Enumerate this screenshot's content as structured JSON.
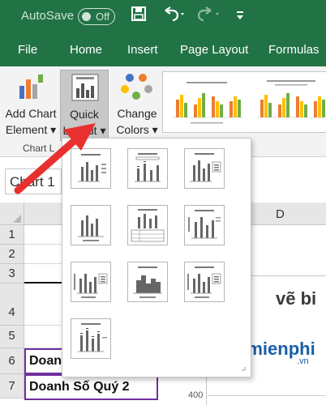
{
  "titlebar": {
    "autosave": "AutoSave",
    "toggle_state": "Off"
  },
  "tabs": [
    "File",
    "Home",
    "Insert",
    "Page Layout",
    "Formulas"
  ],
  "ribbon": {
    "add_chart": [
      "Add Chart",
      "Element ▾"
    ],
    "quick_layout": [
      "Quick",
      "Layout ▾"
    ],
    "change_colors": [
      "Change",
      "Colors ▾"
    ],
    "group_label": "Chart L"
  },
  "name_box": "Chart 1",
  "column_d": "D",
  "rows": [
    "1",
    "2",
    "3",
    "4",
    "5",
    "6",
    "7"
  ],
  "cells": {
    "row6": "Doan",
    "row7": "Doanh Số Quý 2"
  },
  "chart_title": "vẽ bi",
  "axis_tick": "400",
  "watermark": {
    "name": "aimienphi",
    "tld": ".vn"
  },
  "accent_color": "#217346",
  "arrow_color": "#e8312f"
}
